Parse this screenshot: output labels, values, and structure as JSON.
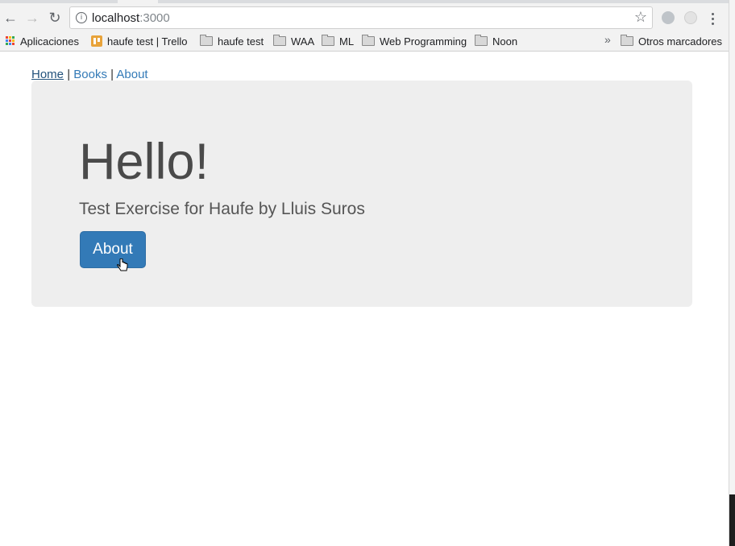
{
  "browser": {
    "url_host": "localhost",
    "url_port": ":3000",
    "bookmarks": [
      "Aplicaciones",
      "haufe test | Trello",
      "haufe test",
      "WAA",
      "ML",
      "Web Programming",
      "Noon"
    ],
    "other_bookmarks": "Otros marcadores"
  },
  "nav": {
    "home": "Home",
    "sep1": "|",
    "books": "Books",
    "sep2": "|",
    "about": "About"
  },
  "jumbotron": {
    "heading": "Hello!",
    "lead": "Test Exercise for Haufe by Lluis Suros",
    "button": "About"
  },
  "colors": {
    "primary": "#337ab7",
    "jumbotron_bg": "#eeeeee"
  }
}
